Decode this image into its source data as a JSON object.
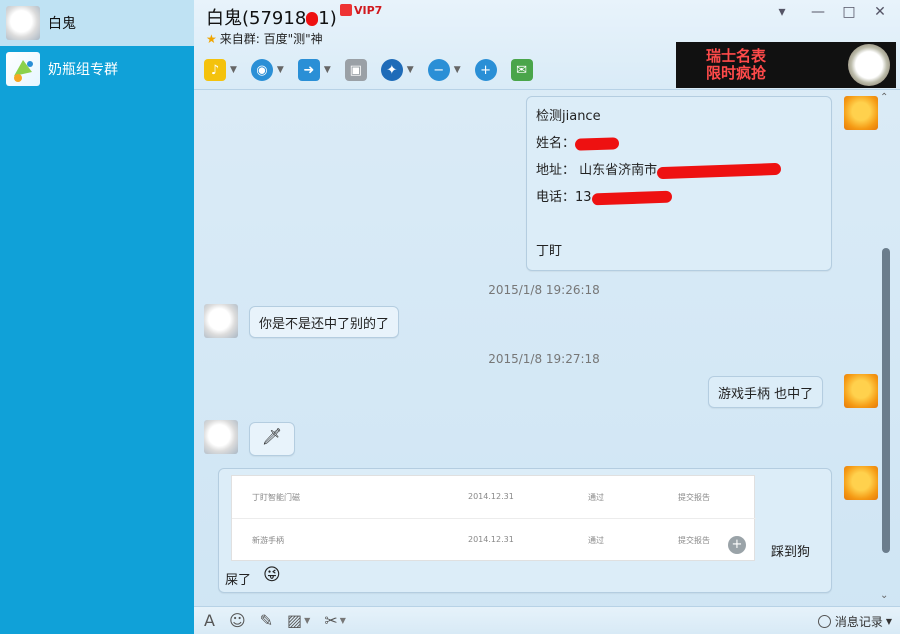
{
  "sidebar": {
    "contacts": [
      {
        "name": "白鬼",
        "active": true
      },
      {
        "name": "奶瓶组专群",
        "active": false
      }
    ]
  },
  "header": {
    "title": "白鬼(57918",
    "title_end": "1)",
    "vip_label": "VIP7",
    "subtitle_prefix": "来自群:",
    "subtitle_group": "百度\"测\"神",
    "window_controls": [
      "▾",
      "—",
      "□",
      "✕"
    ]
  },
  "toolbar": {
    "tools": [
      {
        "icon": "microphone-icon",
        "color": "#f4c20d",
        "glyph": "🎙",
        "dropdown": true
      },
      {
        "icon": "webcam-icon",
        "color": "#2a8fd6",
        "glyph": "◉",
        "dropdown": true
      },
      {
        "icon": "file-transfer-icon",
        "color": "#2a8fd6",
        "glyph": "➜",
        "dropdown": true
      },
      {
        "icon": "remote-desktop-icon",
        "color": "#8a8f94",
        "glyph": "▣",
        "dropdown": false
      },
      {
        "icon": "app-icon",
        "color": "#1e6bb8",
        "glyph": "✦",
        "dropdown": true
      },
      {
        "icon": "remove-user-icon",
        "color": "#2a8fd6",
        "glyph": "−",
        "dropdown": true
      },
      {
        "icon": "add-user-icon",
        "color": "#2a8fd6",
        "glyph": "+",
        "dropdown": false
      },
      {
        "icon": "new-chat-icon",
        "color": "#4aa54a",
        "glyph": "✉",
        "dropdown": false
      }
    ]
  },
  "ad": {
    "line1": "瑞士名表",
    "line2": "限时疯抢"
  },
  "chat": {
    "msg1": {
      "title": "检测jiance",
      "name_label": "姓名：",
      "address_label": "地址：",
      "address_value": "山东省济南市",
      "phone_label": "电话：",
      "phone_value": "13",
      "signature": "丁盯"
    },
    "ts1": "2015/1/8 19:26:18",
    "msg2": "你是不是还中了别的了",
    "ts2": "2015/1/8 19:27:18",
    "msg3": "游戏手柄 也中了",
    "msg4_emoji": "🗡",
    "msg5": {
      "rows": [
        {
          "name": "丁盯智能门磁",
          "date": "2014.12.31",
          "status": "通过",
          "action": "提交报告"
        },
        {
          "name": "新游手柄",
          "date": "2014.12.31",
          "status": "通过",
          "action": "提交报告"
        }
      ],
      "side_text": "踩到狗",
      "footer_text": "屎了",
      "footer_emoji": "😜"
    }
  },
  "bottom": {
    "tools": [
      "A",
      "☺",
      "✎",
      "▨",
      "✂"
    ],
    "history_label": "消息记录"
  }
}
